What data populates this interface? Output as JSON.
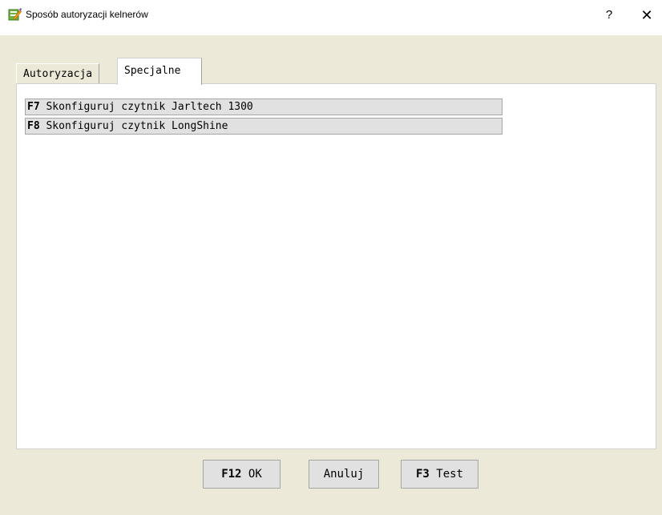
{
  "window": {
    "title": "Sposób autoryzacji kelnerów",
    "help_label": "?",
    "close_label": "✕"
  },
  "tabs": [
    {
      "label": "Autoryzacja",
      "active": false
    },
    {
      "label": "Specjalne",
      "active": true
    }
  ],
  "special_actions": [
    {
      "key": "F7",
      "label": " Skonfiguruj czytnik Jarltech 1300"
    },
    {
      "key": "F8",
      "label": " Skonfiguruj czytnik LongShine"
    }
  ],
  "footer": {
    "ok_key": "F12",
    "ok_label": " OK",
    "cancel_label": "Anuluj",
    "test_key": "F3",
    "test_label": " Test"
  }
}
